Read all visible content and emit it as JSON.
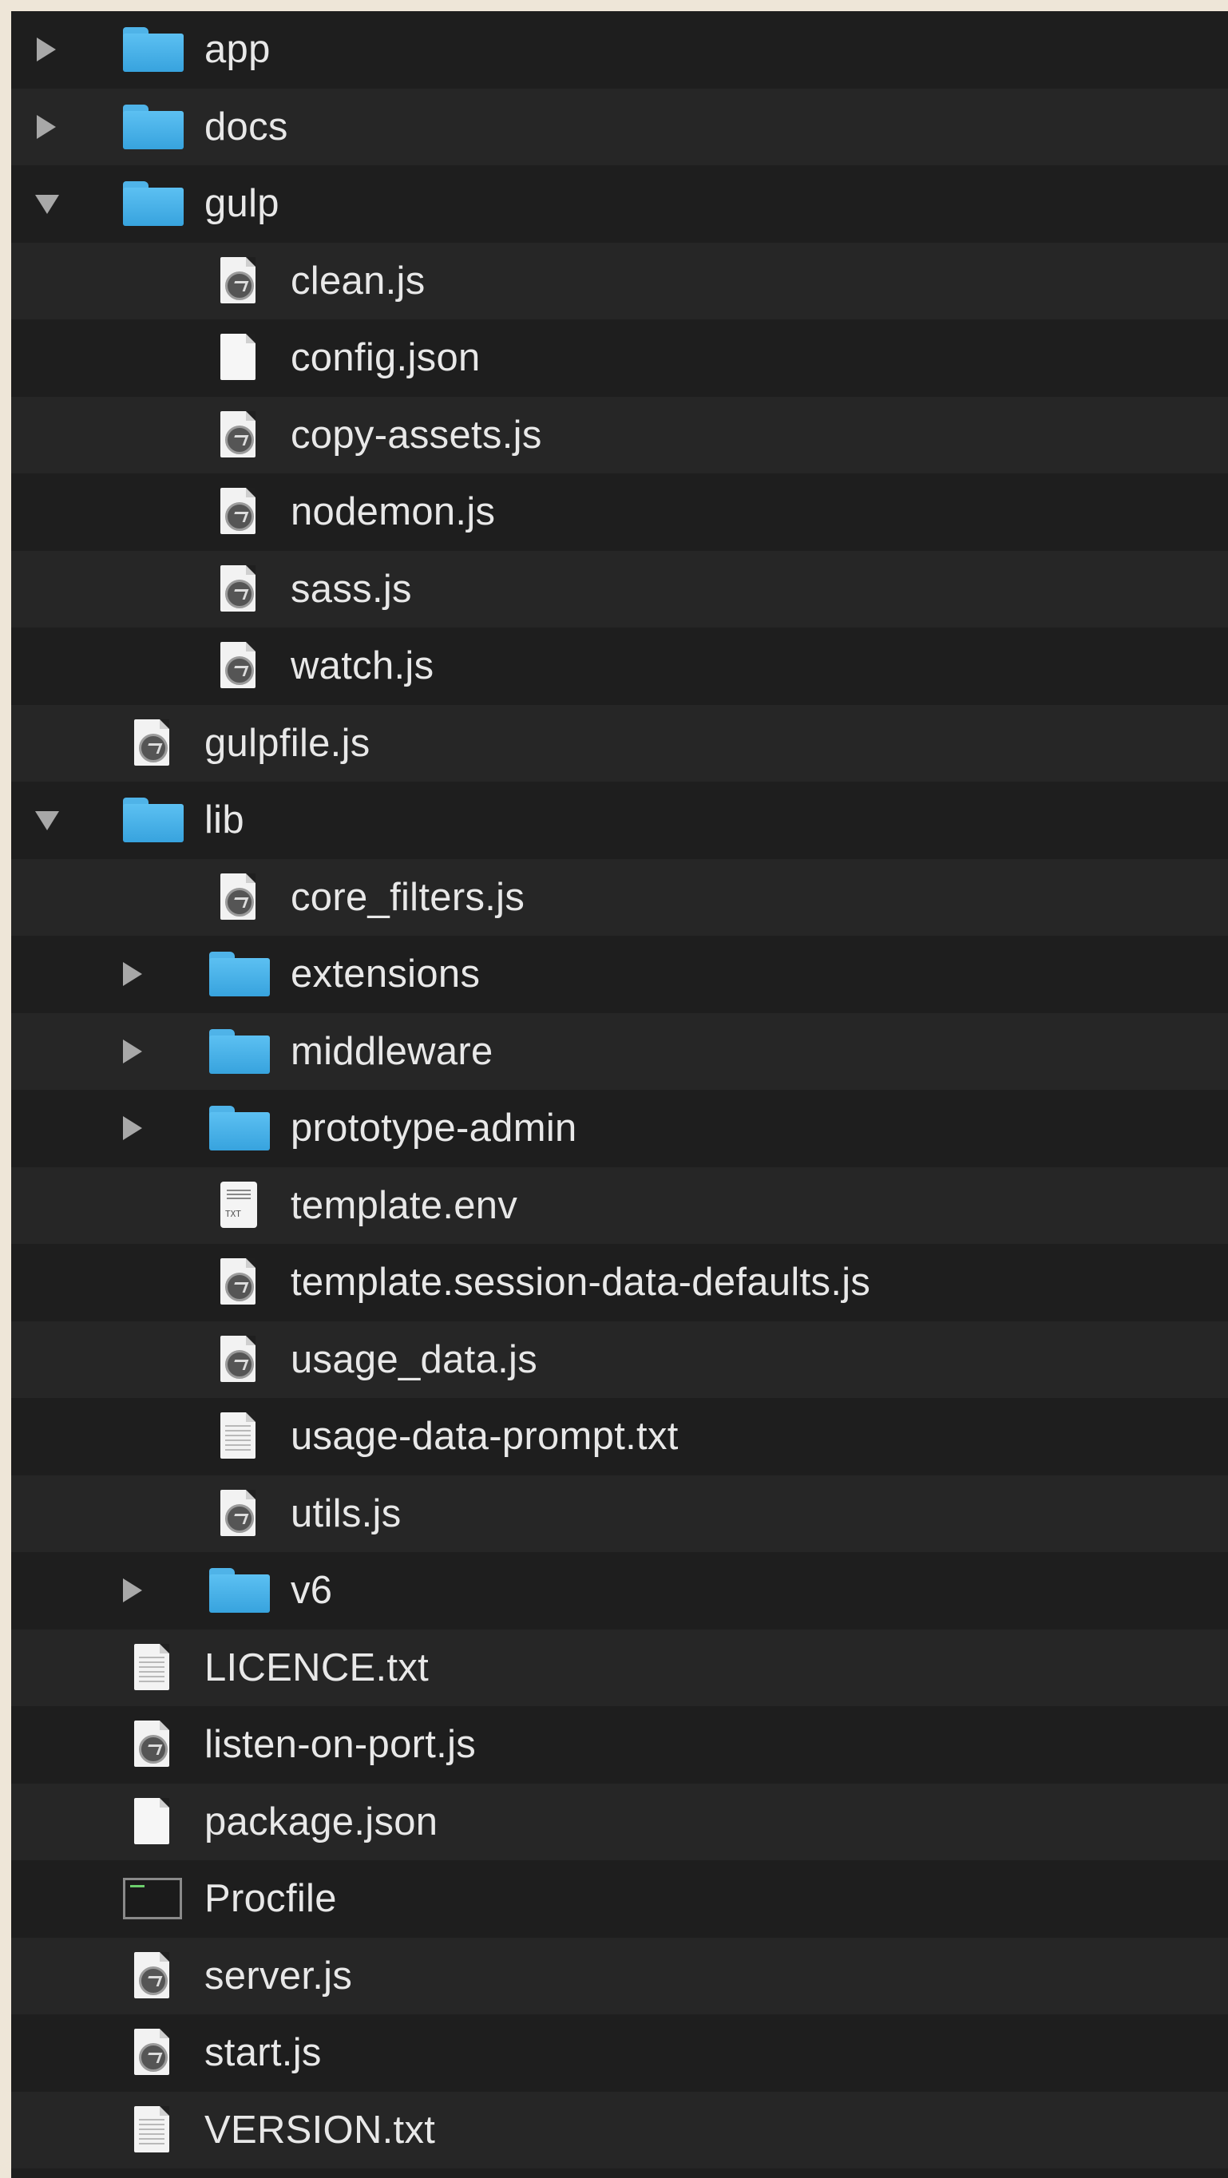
{
  "finder_list": {
    "items": [
      {
        "label": "app",
        "type": "folder",
        "disclosure": "right",
        "depth": 0
      },
      {
        "label": "docs",
        "type": "folder",
        "disclosure": "right",
        "depth": 0
      },
      {
        "label": "gulp",
        "type": "folder",
        "disclosure": "down",
        "depth": 0
      },
      {
        "label": "clean.js",
        "type": "js",
        "disclosure": "none",
        "depth": 1
      },
      {
        "label": "config.json",
        "type": "doc",
        "disclosure": "none",
        "depth": 1
      },
      {
        "label": "copy-assets.js",
        "type": "js",
        "disclosure": "none",
        "depth": 1
      },
      {
        "label": "nodemon.js",
        "type": "js",
        "disclosure": "none",
        "depth": 1
      },
      {
        "label": "sass.js",
        "type": "js",
        "disclosure": "none",
        "depth": 1
      },
      {
        "label": "watch.js",
        "type": "js",
        "disclosure": "none",
        "depth": 1
      },
      {
        "label": "gulpfile.js",
        "type": "js",
        "disclosure": "none",
        "depth": 0
      },
      {
        "label": "lib",
        "type": "folder",
        "disclosure": "down",
        "depth": 0
      },
      {
        "label": "core_filters.js",
        "type": "js",
        "disclosure": "none",
        "depth": 1
      },
      {
        "label": "extensions",
        "type": "folder",
        "disclosure": "right",
        "depth": 1
      },
      {
        "label": "middleware",
        "type": "folder",
        "disclosure": "right",
        "depth": 1
      },
      {
        "label": "prototype-admin",
        "type": "folder",
        "disclosure": "right",
        "depth": 1
      },
      {
        "label": "template.env",
        "type": "env",
        "disclosure": "none",
        "depth": 1
      },
      {
        "label": "template.session-data-defaults.js",
        "type": "js",
        "disclosure": "none",
        "depth": 1
      },
      {
        "label": "usage_data.js",
        "type": "js",
        "disclosure": "none",
        "depth": 1
      },
      {
        "label": "usage-data-prompt.txt",
        "type": "txt",
        "disclosure": "none",
        "depth": 1
      },
      {
        "label": "utils.js",
        "type": "js",
        "disclosure": "none",
        "depth": 1
      },
      {
        "label": "v6",
        "type": "folder",
        "disclosure": "right",
        "depth": 1
      },
      {
        "label": "LICENCE.txt",
        "type": "txt",
        "disclosure": "none",
        "depth": 0
      },
      {
        "label": "listen-on-port.js",
        "type": "js",
        "disclosure": "none",
        "depth": 0
      },
      {
        "label": "package.json",
        "type": "doc",
        "disclosure": "none",
        "depth": 0
      },
      {
        "label": "Procfile",
        "type": "terminal",
        "disclosure": "none",
        "depth": 0
      },
      {
        "label": "server.js",
        "type": "js",
        "disclosure": "none",
        "depth": 0
      },
      {
        "label": "start.js",
        "type": "js",
        "disclosure": "none",
        "depth": 0
      },
      {
        "label": "VERSION.txt",
        "type": "txt",
        "disclosure": "none",
        "depth": 0
      }
    ]
  },
  "colors": {
    "folder_blue": "#4fb3e8",
    "row_dark": "#1e1e1e",
    "row_light": "#262626",
    "text": "#e8e8e8"
  }
}
